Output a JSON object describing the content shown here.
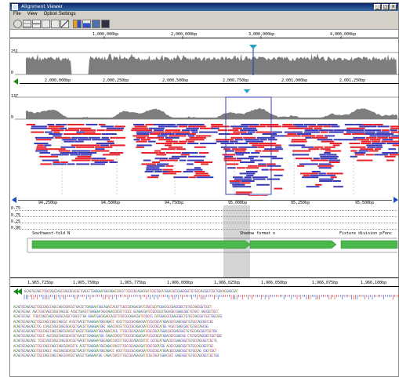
{
  "window": {
    "title": "Alignment Viewer"
  },
  "menu": [
    "File",
    "View",
    "Option Settings"
  ],
  "toolbar": {
    "buttons": [
      "open-icon",
      "grid-icon",
      "split-icon",
      "zoom-in-icon",
      "pointer-icon",
      "line-icon",
      "color-icon",
      "bar-icon",
      "save-icon",
      "print-icon"
    ]
  },
  "overview": {
    "ticks": [
      "1,000,000bp",
      "2,000,000bp",
      "3,000,000bp",
      "4,000,000bp"
    ],
    "ymax": "251",
    "ymin": "0"
  },
  "detail": {
    "ticks": [
      "2,000,000bp",
      "2,000,250bp",
      "2,000,500bp",
      "2,000,750bp",
      "2,001,000bp",
      "2,001,250bp"
    ],
    "ymax": "137",
    "ymin": "0"
  },
  "gene_panel": {
    "ticks": [
      "94,250bp",
      "94,500bp",
      "94,750bp",
      "95,000bp",
      "95,250bp",
      "95,500bp"
    ],
    "row_labels": [
      "0.75",
      "0.75",
      "0.25",
      "0.00"
    ],
    "genes": [
      "Southwest-fold N",
      "Shadow format n",
      "Fixture division p",
      "Fenc"
    ]
  },
  "seq_panel": {
    "ticks": [
      "1,965,725bp",
      "1,965,750bp",
      "1,965,775bp",
      "1,966,000bp",
      "1,966,025bp",
      "1,966,050bp",
      "1,966,075bp",
      "1,966,100bp"
    ],
    "reference": "GCAGTGCAGCTCGCCAGCCAGCCAGCGCACGCTGACGTTGAGGAATGGCAGACCACGTTCGCCGCAGACGATCCGCCGCATGGACGCCGAGCGGCTGTGCCAGCGGTCGCTGGCACGAGCGAT",
    "reads": [
      "ACAGTGCAGCAGCTCGCCAGCCAGCCAGCGCACGCTGACGTTGAGGAATGGCAGACCACGTTCGCCGCAGACGATCCGCCGCATGGACGCCGAGCGGCTGTGCCAGCGGTCGCT",
      "ACAGTGCAGC AGCTCGCCAGCCAGCCAGCGC ACGCTGACGTTGAGGAATGGCAGACCACGTTCGCC GCAGACGATCCGCCGCATGGACGCCGAGCGGCTGTGCC AGCGGTCGCT",
      "ACAGTGCAGC TCGCCAGCCAGCCAGCGCACGCTGACGTTGA GGAATGGCAGACCACGTTCGCCGCAGACGATCCGCCG CATGGACGCCGAGCGGCTGTGCCAGCGGTCGCTGGCACG",
      "ACAGTGCAGCAGCTCGCCAGCCAGCCAGCGC ACGCTGACGTTGAGGAATGGCAGACC ACGTTCGCCGCAGACGATCCGCCGCATGGACGCCGAGCGGCTGTGCCAGCGGTCGC",
      "ACAGTGCAGCAGCTCG CCAGCCAGCCAGCGCACGCTGACGTTGAGGAATGGC AGACCACGTTCGCCGCAGACGATCCGCCGCATGG ACGCCGAGCGGCTGTGCCAGCGG",
      "ACAGTGCAGCAGCTCGCCAGCCAGCCAGCGCACGCTGACGTTGAGGAATGGCAGACCACG TTCGCCGCAGACGATCCGCCGCATGGACGCCGAGCGGCTGTGCCAGCGGTCGCTGG",
      "ACAGTGCAGCAGCTCGCC AGCCAGCCAGCGCACGCTGACGTTGAGGAATGG CAGACCACGTTCGCCGCAGACGATCCGCCGCATGGACGCCGAGCGG CTGTGCCAGCGGTCGCTGGC",
      "ACAGTGCAGCAGC TCGCCAGCCAGCCAGCGCACGCTGACGTTGAGGAATGGCAGACCACGTTCGCCGCAGACGATCC GCCGCATGGACGCCGAGCGGCTGTGCCAGCGGTCGCTG",
      "ACAGTGCAGCAGCTCGCCAGCCAGCCAGCGCACGCTG ACGTTGAGGAATGGCAGACCACGTTCGCCGCAGACGATCCGCCGCATGG ACGCCGAGCGGCTGTGCCAGCGGTCGC",
      "ACAGTGCAGCAGCTCGCCAGCC AGCCAGCGCACGCTGACGTTGAGGAATGGCAGACC ACGTTCGCCGCAGACGATCCGCCGCATGGACGCCGAGCGGCTGTGCCAG CGGTCGCT",
      "ACAGTGCAGCAGCTCGCCAGCCAGCCAGCGCACGCTGACGTTGAGGAATGG CAGACCACGTTCGCCGCAGACGATCCGCCGCATGGACGCC GAGCGGCTGTGCCAGCGGTCGCTGG"
    ]
  },
  "colors": {
    "forward_read": "#e8202a",
    "reverse_read": "#3a3ab8",
    "coverage": "#7d7d7d",
    "gene": "#4ab84a",
    "marker": "#29a0c8",
    "highlight_box": "#4040b0"
  }
}
